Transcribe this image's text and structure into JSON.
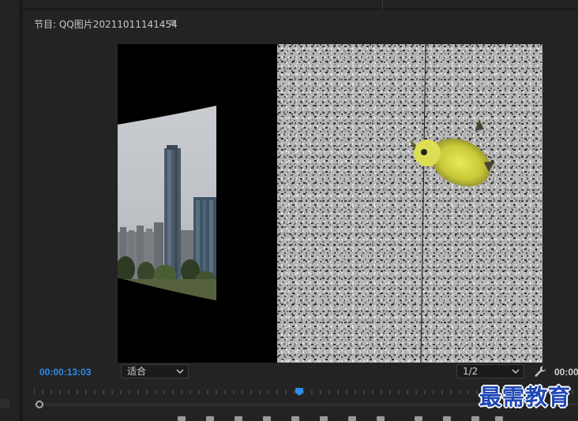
{
  "panel": {
    "title": "节目: QQ图片20211011141454",
    "menu_glyph": "≡"
  },
  "playback": {
    "current_timecode": "00:00:13:03",
    "duration_visible": "00:00"
  },
  "zoom_fit": {
    "selected": "适合"
  },
  "resolution": {
    "selected": "1/2"
  },
  "colors": {
    "timecode": "#2d8ceb",
    "playhead": "#2d8ceb",
    "panel_bg": "#232323",
    "watermark": "#1f47b5"
  },
  "icons": {
    "menu": "hamburger-icon",
    "settings": "wrench-icon",
    "dropdown": "chevron-down-icon",
    "playhead": "playhead-marker-icon"
  },
  "watermark": {
    "text": "最需教育"
  }
}
